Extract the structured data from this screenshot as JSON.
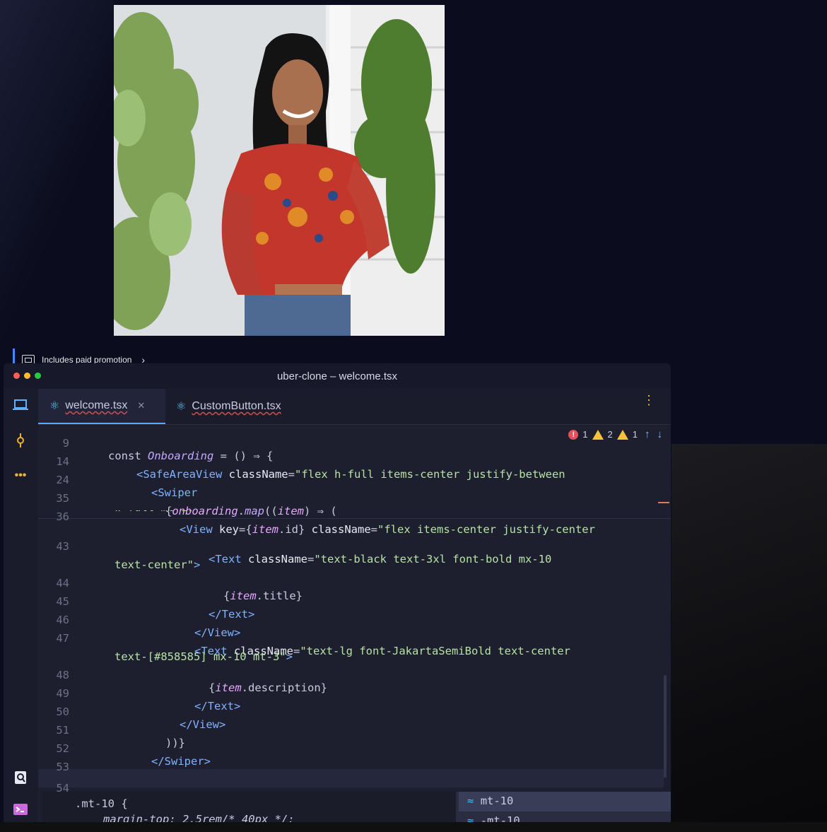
{
  "promo": {
    "label": "Includes paid promotion"
  },
  "window": {
    "title": "uber-clone – welcome.tsx"
  },
  "tabs": [
    {
      "label": "welcome.tsx",
      "active": true
    },
    {
      "label": "CustomButton.tsx",
      "active": false
    }
  ],
  "issues": {
    "errors": "1",
    "warnings": "2",
    "weak_warnings": "1"
  },
  "line_numbers": [
    "9",
    "14",
    "24",
    "35",
    "36",
    "43",
    "44",
    "45",
    "46",
    "47",
    "48",
    "49",
    "50",
    "51",
    "52",
    "53",
    "54"
  ],
  "popup": {
    "selector": ".mt-10 {",
    "rule": "margin-top: 2.5rem/* 40px */;"
  },
  "completion": {
    "items": [
      "mt-10",
      "-mt-10"
    ]
  },
  "colors": {
    "accent": "#5aa8ff",
    "editor_bg": "#1e1f2e",
    "error": "#e0525b",
    "warning": "#f3c43b"
  }
}
